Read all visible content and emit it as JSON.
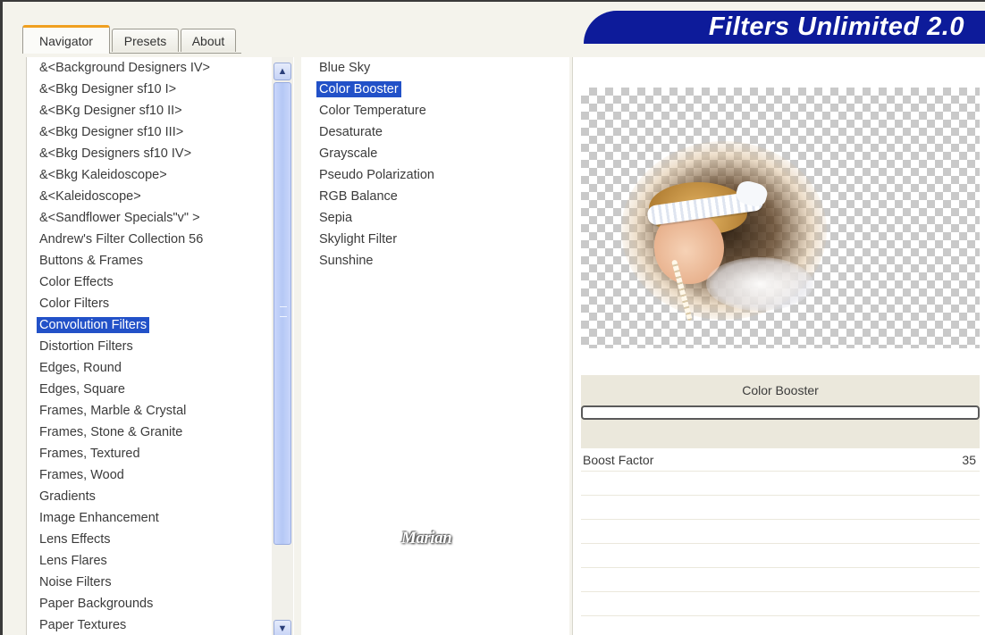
{
  "app": {
    "title": "Filters Unlimited 2.0"
  },
  "tabs": [
    {
      "label": "Navigator",
      "active": true
    },
    {
      "label": "Presets",
      "active": false
    },
    {
      "label": "About",
      "active": false
    }
  ],
  "categories": {
    "selected_index": 12,
    "items": [
      "&<Background Designers IV>",
      "&<Bkg Designer sf10 I>",
      "&<BKg Designer sf10 II>",
      "&<Bkg Designer sf10 III>",
      "&<Bkg Designers sf10 IV>",
      "&<Bkg Kaleidoscope>",
      "&<Kaleidoscope>",
      "&<Sandflower Specials\"v\" >",
      "Andrew's Filter Collection 56",
      "Buttons & Frames",
      "Color Effects",
      "Color Filters",
      "Convolution Filters",
      "Distortion Filters",
      "Edges, Round",
      "Edges, Square",
      "Frames, Marble & Crystal",
      "Frames, Stone & Granite",
      "Frames, Textured",
      "Frames, Wood",
      "Gradients",
      "Image Enhancement",
      "Lens Effects",
      "Lens Flares",
      "Noise Filters",
      "Paper Backgrounds",
      "Paper Textures"
    ]
  },
  "filters": {
    "selected_index": 1,
    "items": [
      "Blue Sky",
      "Color Booster",
      "Color Temperature",
      "Desaturate",
      "Grayscale",
      "Pseudo Polarization",
      "RGB Balance",
      "Sepia",
      "Skylight Filter",
      "Sunshine"
    ]
  },
  "watermark": "Marian",
  "preview": {
    "filter_name": "Color Booster",
    "progress_fraction": 0.0
  },
  "parameters": [
    {
      "label": "Boost Factor",
      "value": "35"
    }
  ],
  "colors": {
    "banner": "#0d1b9a",
    "selection": "#2251c8",
    "active_tab_accent": "#f0a020"
  },
  "icons": {
    "scroll_up": "▲",
    "scroll_down": "▼"
  }
}
